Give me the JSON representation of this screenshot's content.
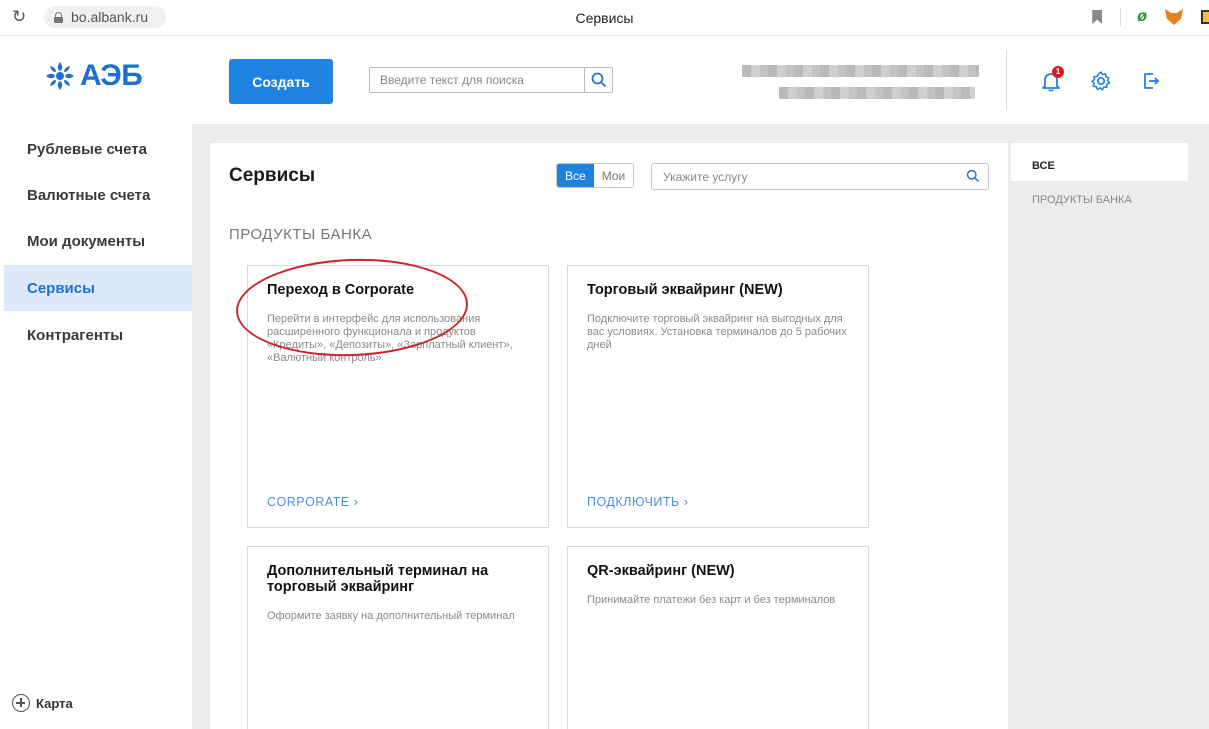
{
  "browser": {
    "url": "bo.albank.ru",
    "tab_title": "Сервисы"
  },
  "header": {
    "logo_text": "АЭБ",
    "create_label": "Создать",
    "search_placeholder": "Введите текст для поиска",
    "notifications_count": "1"
  },
  "sidebar": {
    "items": [
      {
        "label": "Рублевые счета",
        "active": false
      },
      {
        "label": "Валютные счета",
        "active": false
      },
      {
        "label": "Мои документы",
        "active": false
      },
      {
        "label": "Сервисы",
        "active": true
      },
      {
        "label": "Контрагенты",
        "active": false
      }
    ],
    "map_label": "Карта"
  },
  "main": {
    "title": "Сервисы",
    "filter": {
      "all": "Все",
      "mine": "Мои",
      "selected": "Все"
    },
    "service_search_placeholder": "Укажите услугу",
    "section_title": "ПРОДУКТЫ БАНКА",
    "cards": [
      {
        "title": "Переход в Corporate",
        "desc": "Перейти в интерфейс для использования расширенного функционала и продуктов «Кредиты», «Депозиты», «Зарплатный клиент», «Валютный контроль»",
        "link": "CORPORATE"
      },
      {
        "title": "Торговый эквайринг (NEW)",
        "desc": "Подключите торговый эквайринг на выгодных для вас условиях. Установка терминалов до 5 рабочих дней",
        "link": "ПОДКЛЮЧИТЬ"
      },
      {
        "title": "Дополнительный терминал на торговый эквайринг",
        "desc": "Оформите заявку на дополнительный терминал",
        "link": ""
      },
      {
        "title": "QR-эквайринг (NEW)",
        "desc": "Принимайте платежи без карт и без терминалов",
        "link": ""
      }
    ]
  },
  "right_panel": {
    "items": [
      "ВСЕ",
      "ПРОДУКТЫ БАНКА"
    ]
  },
  "colors": {
    "accent": "#1e82e0",
    "brand": "#1e6fd0",
    "annotation": "#c8262c"
  }
}
